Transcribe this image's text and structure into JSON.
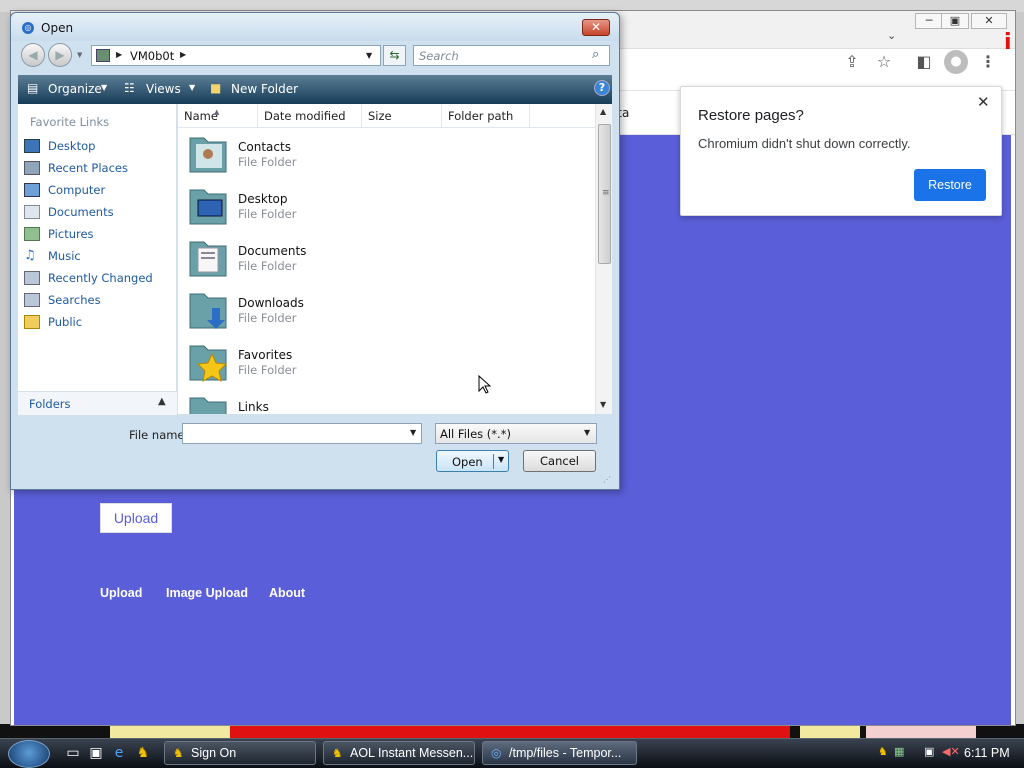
{
  "browser": {
    "window_controls": [
      "─",
      "▣",
      "✕"
    ],
    "toolbar_icons": [
      "share-icon",
      "star-icon",
      "sidepanel-icon",
      "profile-icon",
      "menu-icon"
    ],
    "bookmark_partial": "sta",
    "page": {
      "upload_button": "Upload",
      "footer_links": [
        "Upload",
        "Image Upload",
        "About"
      ],
      "accent": "#5a5fd9"
    }
  },
  "restore_popup": {
    "title": "Restore pages?",
    "message": "Chromium didn't shut down correctly.",
    "button": "Restore",
    "close": "✕"
  },
  "dialog": {
    "title": "Open",
    "address": "VM0b0t",
    "search_placeholder": "Search",
    "commands": {
      "organize": "Organize",
      "views": "Views",
      "new_folder": "New Folder"
    },
    "nav": {
      "header": "Favorite Links",
      "items": [
        {
          "label": "Desktop",
          "icon": "desktop-icon"
        },
        {
          "label": "Recent Places",
          "icon": "recent-places-icon"
        },
        {
          "label": "Computer",
          "icon": "computer-icon"
        },
        {
          "label": "Documents",
          "icon": "documents-icon"
        },
        {
          "label": "Pictures",
          "icon": "pictures-icon"
        },
        {
          "label": "Music",
          "icon": "music-icon"
        },
        {
          "label": "Recently Changed",
          "icon": "recently-changed-icon"
        },
        {
          "label": "Searches",
          "icon": "searches-icon"
        },
        {
          "label": "Public",
          "icon": "public-folder-icon"
        }
      ],
      "folders": "Folders"
    },
    "columns": [
      "Name",
      "Date modified",
      "Size",
      "Folder path"
    ],
    "files": [
      {
        "name": "Contacts",
        "type": "File Folder",
        "icon": "contacts-folder-icon"
      },
      {
        "name": "Desktop",
        "type": "File Folder",
        "icon": "desktop-folder-icon"
      },
      {
        "name": "Documents",
        "type": "File Folder",
        "icon": "documents-folder-icon"
      },
      {
        "name": "Downloads",
        "type": "File Folder",
        "icon": "downloads-folder-icon"
      },
      {
        "name": "Favorites",
        "type": "File Folder",
        "icon": "favorites-folder-icon"
      },
      {
        "name": "Links",
        "type": "",
        "icon": "links-folder-icon"
      }
    ],
    "file_name_label": "File name:",
    "file_name_value": "",
    "filter": "All Files (*.*)",
    "open_button": "Open",
    "cancel_button": "Cancel"
  },
  "taskbar": {
    "tasks": [
      {
        "label": "Sign On",
        "icon": "aim-icon"
      },
      {
        "label": "AOL Instant Messen...",
        "icon": "aim-icon"
      },
      {
        "label": "/tmp/files - Tempor...",
        "icon": "chromium-icon"
      }
    ],
    "clock": "6:11 PM"
  }
}
